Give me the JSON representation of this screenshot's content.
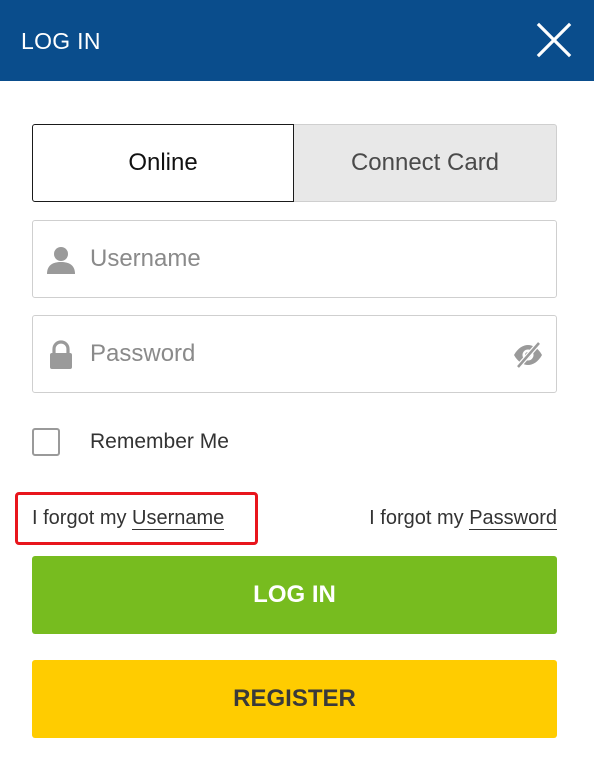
{
  "header": {
    "title": "LOG IN",
    "close_icon": "close-icon",
    "background": "#0a4d8c"
  },
  "tabs": [
    {
      "label": "Online",
      "selected": true
    },
    {
      "label": "Connect Card",
      "selected": false
    }
  ],
  "username": {
    "placeholder": "Username",
    "value": "",
    "icon": "user-icon"
  },
  "password": {
    "placeholder": "Password",
    "value": "",
    "icon": "lock-icon",
    "toggle_icon": "eye-slash-icon"
  },
  "remember": {
    "label": "Remember Me",
    "checked": false
  },
  "forgot_username": {
    "prefix": "I forgot my ",
    "link": "Username",
    "highlight_color": "#e8151c"
  },
  "forgot_password": {
    "prefix": "I forgot my ",
    "link": "Password"
  },
  "login_button": {
    "label": "LOG IN",
    "color": "#77bc1f"
  },
  "register_button": {
    "label": "REGISTER",
    "color": "#ffcc00"
  }
}
